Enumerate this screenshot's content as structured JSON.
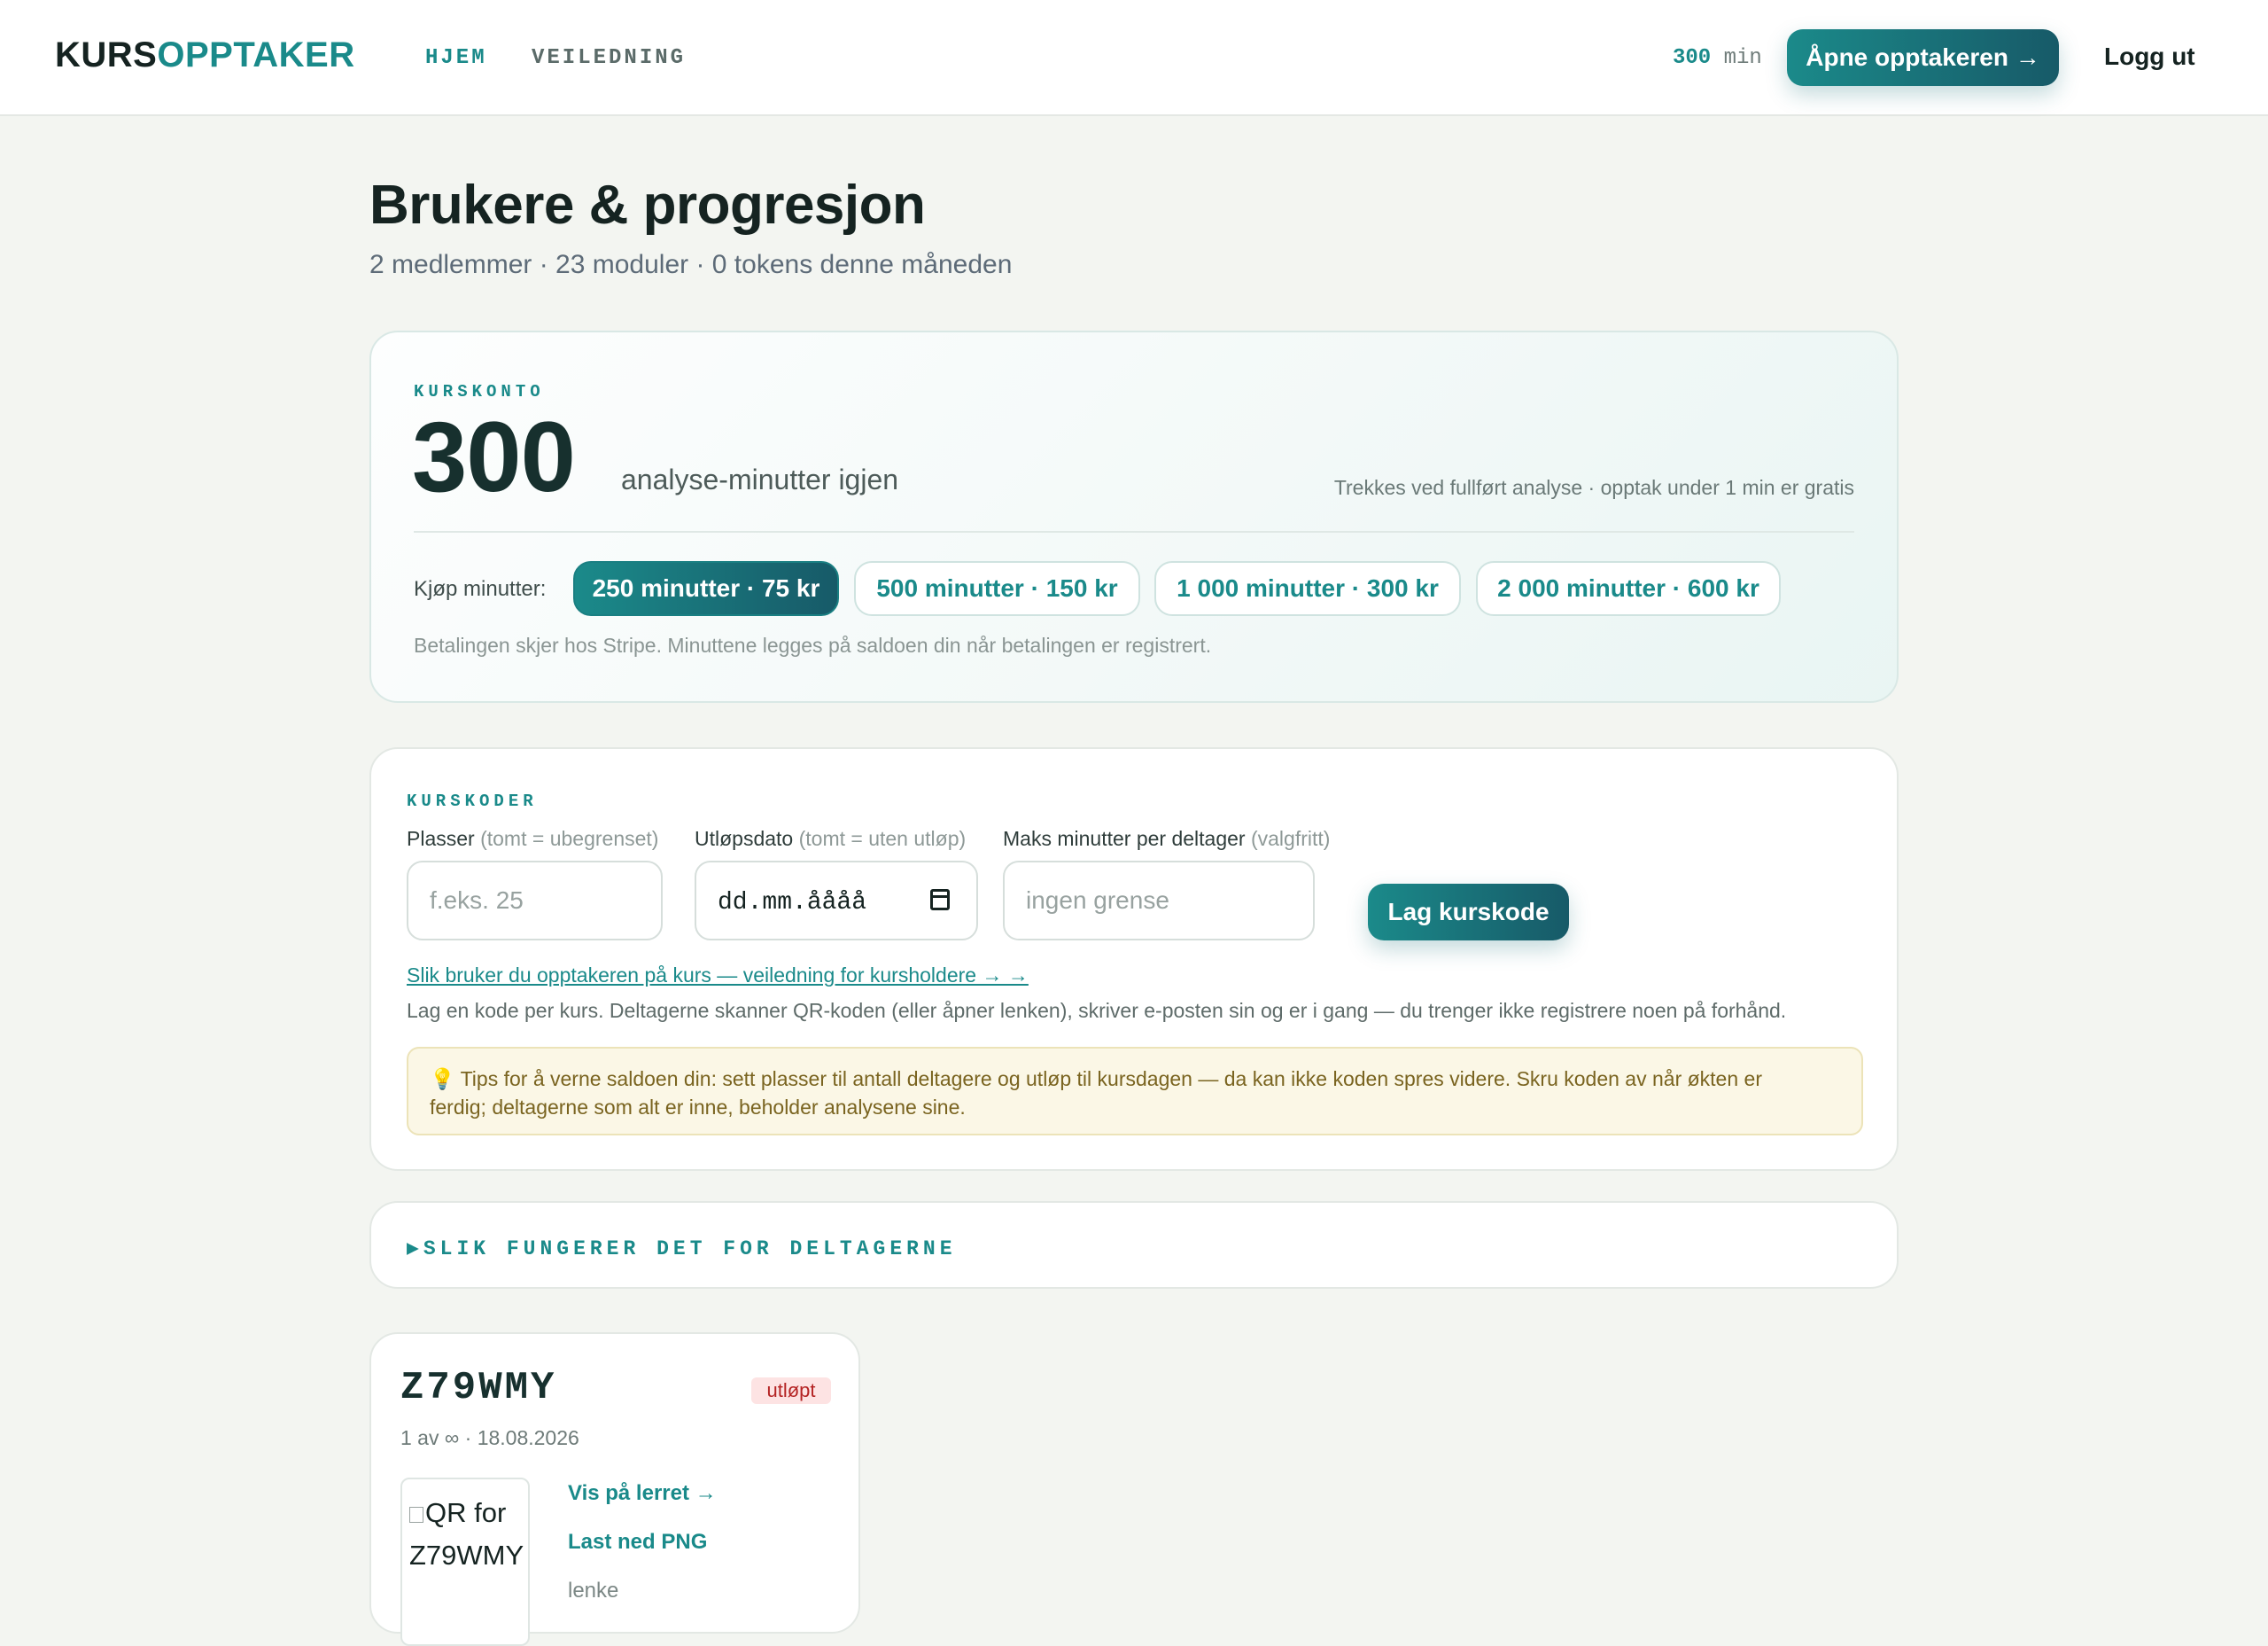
{
  "header": {
    "logo_part1": "KURS",
    "logo_part2": "OPPTAKER",
    "nav": {
      "home": "HJEM",
      "guide": "VEILEDNING"
    },
    "balance_value": "300",
    "balance_unit": "min",
    "open_recorder": "Åpne opptakeren →",
    "logout": "Logg ut"
  },
  "page": {
    "title": "Brukere & progresjon",
    "subtitle": "2 medlemmer · 23 moduler · 0 tokens denne måneden"
  },
  "account": {
    "kicker": "KURSKONTO",
    "minutes": "300",
    "minutes_label": "analyse-minutter igjen",
    "note": "Trekkes ved fullført analyse · opptak under 1 min er gratis",
    "buy_label": "Kjøp minutter:",
    "packages": [
      {
        "label": "250 minutter · 75 kr",
        "selected": true
      },
      {
        "label": "500 minutter · 150 kr",
        "selected": false
      },
      {
        "label": "1 000 minutter · 300 kr",
        "selected": false
      },
      {
        "label": "2 000 minutter · 600 kr",
        "selected": false
      }
    ],
    "payment_note": "Betalingen skjer hos Stripe. Minuttene legges på saldoen din når betalingen er registrert."
  },
  "codes": {
    "kicker": "KURSKODER",
    "seats_label": "Plasser",
    "seats_hint": "(tomt = ubegrenset)",
    "seats_placeholder": "f.eks. 25",
    "expiry_label": "Utløpsdato",
    "expiry_hint": "(tomt = uten utløp)",
    "expiry_value": "dd.mm.åååå",
    "max_label": "Maks minutter per deltager",
    "max_hint": "(valgfritt)",
    "max_placeholder": "ingen grense",
    "create_button": "Lag kurskode",
    "guide_link": "Slik bruker du opptakeren på kurs — veiledning for kursholdere → →",
    "description": "Lag en kode per kurs. Deltagerne skanner QR-koden (eller åpner lenken), skriver e-posten sin og er i gang — du trenger ikke registrere noen på forhånd.",
    "tip_line1": "💡 Tips for å verne saldoen din: sett plasser til antall deltagere og utløp til kursdagen — da kan ikke koden spres videre. Skru koden av når økten er",
    "tip_line2": "ferdig; deltagerne som alt er inne, beholder analysene sine."
  },
  "howto": {
    "marker": "▶",
    "title": "SLIK FUNGERER DET FOR DELTAGERNE"
  },
  "code_card": {
    "code": "Z79WMY",
    "status": "utløpt",
    "meta": "1 av ∞ · 18.08.2026",
    "qr_alt_line1": "QR for",
    "qr_alt_line2": "Z79WMY",
    "show_on_screen": "Vis på lerret →",
    "download_png": "Last ned PNG",
    "link_label": "lenke"
  }
}
